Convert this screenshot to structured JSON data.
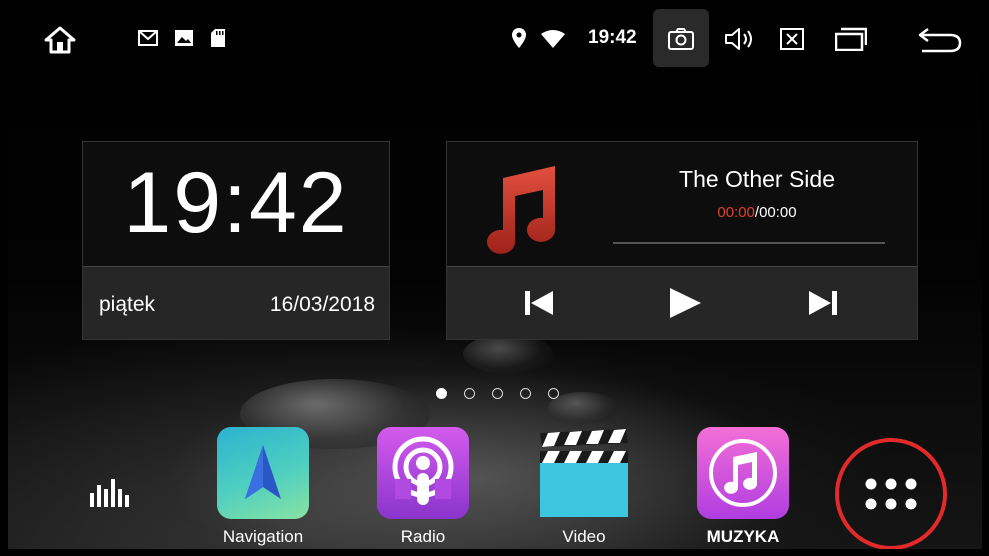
{
  "status_bar": {
    "time": "19:42",
    "icons": [
      "home-icon",
      "gmail-icon",
      "image-icon",
      "sd-card-icon",
      "location-icon",
      "wifi-icon",
      "camera-icon",
      "volume-icon",
      "close-box-icon",
      "recent-apps-icon",
      "back-icon"
    ]
  },
  "clock_widget": {
    "time": "19:42",
    "day": "piątek",
    "date": "16/03/2018"
  },
  "music_widget": {
    "title": "The Other Side",
    "current_time": "00:00",
    "separator": "/",
    "total_time": "00:00",
    "icon": "music-note-icon",
    "progress": 0
  },
  "page_indicator": {
    "count": 5,
    "active_index": 0
  },
  "dock": {
    "apps": [
      {
        "label": "Navigation",
        "icon": "navigation-arrow-icon"
      },
      {
        "label": "Radio",
        "icon": "podcast-icon"
      },
      {
        "label": "Video",
        "icon": "clapperboard-icon"
      },
      {
        "label": "MUZYKA",
        "icon": "music-note-icon"
      }
    ],
    "more_icon": "app-drawer-icon",
    "highlight_color": "#e32a2a"
  },
  "colors": {
    "accent_red": "#e0402a",
    "music_icon_red": "#c8362a",
    "nav_gradient": [
      "#29b6c9",
      "#7de0a6"
    ],
    "radio_gradient": [
      "#c84fe6",
      "#7a2fc8"
    ],
    "video_teal": "#3cc6df",
    "music_pink": [
      "#f06bd8",
      "#b23ee0"
    ]
  }
}
